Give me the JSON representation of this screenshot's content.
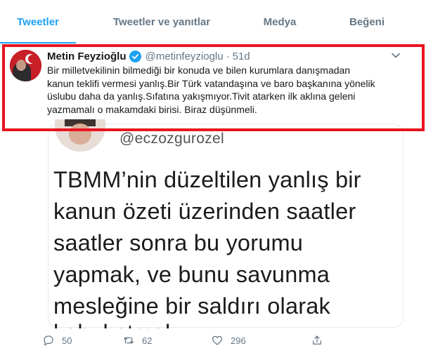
{
  "tabs": [
    {
      "label": "Tweetler",
      "active": true
    },
    {
      "label": "Tweetler ve yanıtlar",
      "active": false
    },
    {
      "label": "Medya",
      "active": false
    },
    {
      "label": "Beğeni",
      "active": false
    }
  ],
  "tweet": {
    "author_name": "Metin Feyzioğlu",
    "handle": "@metinfeyzioglu",
    "separator": "·",
    "time": "51d",
    "text_lines": [
      "Bir milletvekilinin bilmediği bir konuda ve bilen kurumlara danışmadan",
      "kanun teklifi vermesi yanlış.Bir Türk  vatandaşına ve baro başkanına yönelik",
      "üslubu daha da yanlış.Sıfatına  yakışmıyor.Tivit atarken ilk aklına geleni",
      "yazmamalı o makamdaki birisi. Biraz düşünmeli."
    ],
    "media": {
      "handle": "@eczozgurozel",
      "lines": [
        "TBMM’nin düzeltilen yanlış bir",
        "kanun özeti üzerinden saatler",
        "saatler sonra bu yorumu",
        "yapmak, ve bunu savunma",
        "mesleğine bir saldırı olarak"
      ],
      "cut_line": "kabul etmek"
    },
    "counts": {
      "replies": "50",
      "retweets": "62",
      "likes": "296"
    }
  },
  "colors": {
    "accent": "#1da1f2",
    "highlight_border": "#e8141f",
    "secondary_text": "#657786"
  }
}
